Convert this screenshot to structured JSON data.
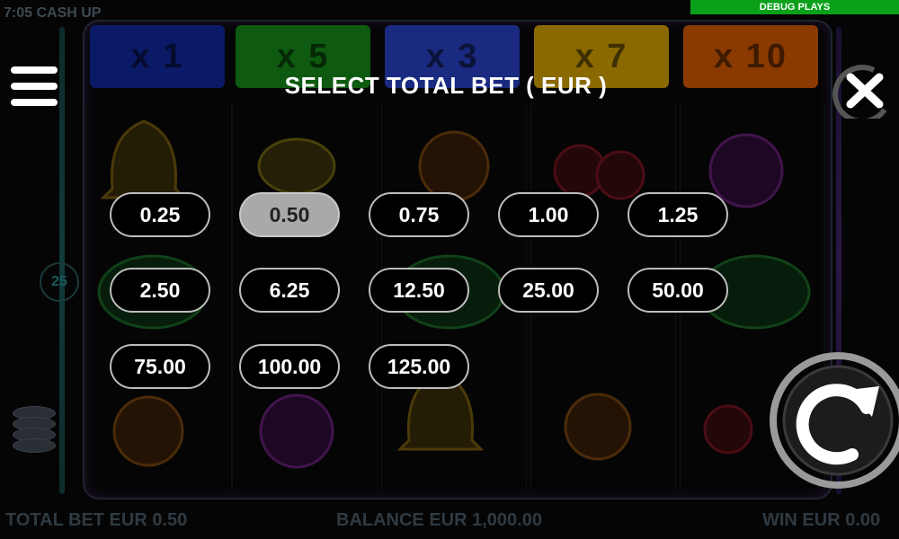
{
  "status": {
    "time_game": "7:05  CASH UP"
  },
  "debug": {
    "label": "DEBUG PLAYS"
  },
  "background": {
    "multipliers": [
      {
        "label": "x 1",
        "color": "#0b1a66"
      },
      {
        "label": "x 5",
        "color": "#0e5a10"
      },
      {
        "label": "x 3",
        "color": "#1a2a80"
      },
      {
        "label": "x 7",
        "color": "#8a6a00"
      },
      {
        "label": "x 10",
        "color": "#8a3a00"
      }
    ],
    "lines_badge": "25"
  },
  "dialog": {
    "title": "SELECT TOTAL BET ( EUR )",
    "selected_value": "0.50",
    "bets": [
      "0.25",
      "0.50",
      "0.75",
      "1.00",
      "1.25",
      "2.50",
      "6.25",
      "12.50",
      "25.00",
      "50.00",
      "75.00",
      "100.00",
      "125.00"
    ]
  },
  "bottom_bar": {
    "total_bet": "TOTAL BET EUR 0.50",
    "balance": "BALANCE EUR 1,000.00",
    "win": "WIN EUR 0.00"
  },
  "icons": {
    "menu": "hamburger-menu-icon",
    "close": "close-icon",
    "spin": "spin-arrow-icon",
    "coins": "coin-stack-icon"
  }
}
